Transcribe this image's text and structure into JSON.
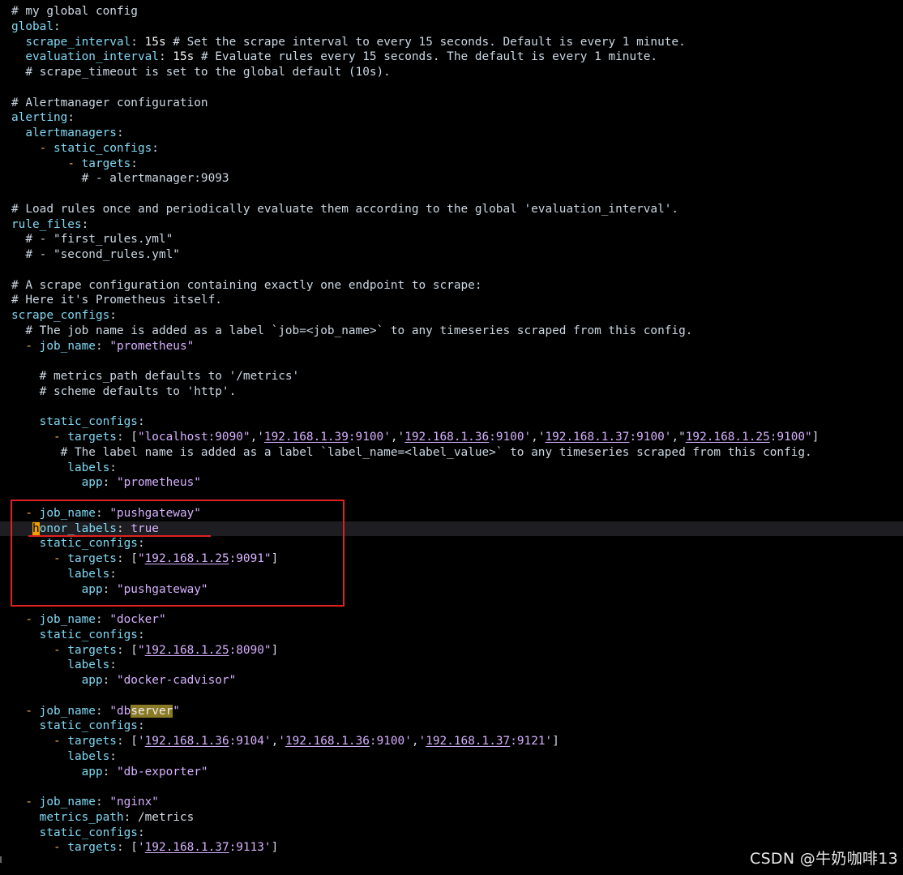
{
  "editor": {
    "lines": [
      [
        {
          "t": "# my global config",
          "c": "comment"
        }
      ],
      [
        {
          "t": "global",
          "c": "key"
        },
        {
          "t": ":",
          "c": "plain"
        }
      ],
      [
        {
          "t": "  scrape_interval",
          "c": "key"
        },
        {
          "t": ": ",
          "c": "plain"
        },
        {
          "t": "15s",
          "c": "num"
        },
        {
          "t": " # Set the scrape interval to every 15 seconds. Default is every 1 minute.",
          "c": "comment"
        }
      ],
      [
        {
          "t": "  evaluation_interval",
          "c": "key"
        },
        {
          "t": ": ",
          "c": "plain"
        },
        {
          "t": "15s",
          "c": "num"
        },
        {
          "t": " # Evaluate rules every 15 seconds. The default is every 1 minute.",
          "c": "comment"
        }
      ],
      [
        {
          "t": "  # scrape_timeout is set to the global default (10s).",
          "c": "comment"
        }
      ],
      [],
      [
        {
          "t": "# Alertmanager configuration",
          "c": "comment"
        }
      ],
      [
        {
          "t": "alerting",
          "c": "key"
        },
        {
          "t": ":",
          "c": "plain"
        }
      ],
      [
        {
          "t": "  alertmanagers",
          "c": "key"
        },
        {
          "t": ":",
          "c": "plain"
        }
      ],
      [
        {
          "t": "    ",
          "c": "plain"
        },
        {
          "t": "-",
          "c": "dash"
        },
        {
          "t": " static_configs",
          "c": "key"
        },
        {
          "t": ":",
          "c": "plain"
        }
      ],
      [
        {
          "t": "        ",
          "c": "plain"
        },
        {
          "t": "-",
          "c": "dash"
        },
        {
          "t": " targets",
          "c": "key"
        },
        {
          "t": ":",
          "c": "plain"
        }
      ],
      [
        {
          "t": "          # - alertmanager:9093",
          "c": "comment"
        }
      ],
      [],
      [
        {
          "t": "# Load rules once and periodically evaluate them according to the global 'evaluation_interval'.",
          "c": "comment"
        }
      ],
      [
        {
          "t": "rule_files",
          "c": "key"
        },
        {
          "t": ":",
          "c": "plain"
        }
      ],
      [
        {
          "t": "  # - \"first_rules.yml\"",
          "c": "comment"
        }
      ],
      [
        {
          "t": "  # - \"second_rules.yml\"",
          "c": "comment"
        }
      ],
      [],
      [
        {
          "t": "# A scrape configuration containing exactly one endpoint to scrape:",
          "c": "comment"
        }
      ],
      [
        {
          "t": "# Here it's Prometheus itself.",
          "c": "comment"
        }
      ],
      [
        {
          "t": "scrape_configs",
          "c": "key"
        },
        {
          "t": ":",
          "c": "plain"
        }
      ],
      [
        {
          "t": "  # The job name is added as a label `job=<job_name>` to any timeseries scraped from this config.",
          "c": "comment"
        }
      ],
      [
        {
          "t": "  ",
          "c": "plain"
        },
        {
          "t": "-",
          "c": "dash"
        },
        {
          "t": " job_name",
          "c": "key"
        },
        {
          "t": ": ",
          "c": "plain"
        },
        {
          "t": "\"prometheus\"",
          "c": "str"
        }
      ],
      [],
      [
        {
          "t": "    # metrics_path defaults to '/metrics'",
          "c": "comment"
        }
      ],
      [
        {
          "t": "    # scheme defaults to 'http'.",
          "c": "comment"
        }
      ],
      [],
      [
        {
          "t": "    static_configs",
          "c": "key"
        },
        {
          "t": ":",
          "c": "plain"
        }
      ],
      [
        {
          "t": "      ",
          "c": "plain"
        },
        {
          "t": "-",
          "c": "dash"
        },
        {
          "t": " targets",
          "c": "key"
        },
        {
          "t": ": [",
          "c": "plain"
        },
        {
          "t": "\"localhost:9090\"",
          "c": "str"
        },
        {
          "t": ",'",
          "c": "plain"
        },
        {
          "t": "192.168.1.39",
          "c": "link"
        },
        {
          "t": ":9100'",
          "c": "str"
        },
        {
          "t": ",'",
          "c": "plain"
        },
        {
          "t": "192.168.1.36",
          "c": "link"
        },
        {
          "t": ":9100'",
          "c": "str"
        },
        {
          "t": ",'",
          "c": "plain"
        },
        {
          "t": "192.168.1.37",
          "c": "link"
        },
        {
          "t": ":9100'",
          "c": "str"
        },
        {
          "t": ",\"",
          "c": "plain"
        },
        {
          "t": "192.168.1.25",
          "c": "link"
        },
        {
          "t": ":9100\"",
          "c": "str"
        },
        {
          "t": "]",
          "c": "plain"
        }
      ],
      [
        {
          "t": "       # The label name is added as a label `label_name=<label_value>` to any timeseries scraped from this config.",
          "c": "comment"
        }
      ],
      [
        {
          "t": "        labels",
          "c": "key"
        },
        {
          "t": ":",
          "c": "plain"
        }
      ],
      [
        {
          "t": "          app",
          "c": "key"
        },
        {
          "t": ": ",
          "c": "plain"
        },
        {
          "t": "\"prometheus\"",
          "c": "str"
        }
      ],
      [],
      [
        {
          "t": "  ",
          "c": "plain"
        },
        {
          "t": "-",
          "c": "dash"
        },
        {
          "t": " job_name",
          "c": "key"
        },
        {
          "t": ": ",
          "c": "plain"
        },
        {
          "t": "\"pushgateway\"",
          "c": "str"
        }
      ],
      [
        {
          "t": "   ",
          "c": "plain"
        },
        {
          "t": "h",
          "c": "cursor"
        },
        {
          "t": "onor_labels",
          "c": "key"
        },
        {
          "t": ": ",
          "c": "plain"
        },
        {
          "t": "true",
          "c": "str"
        }
      ],
      [
        {
          "t": "    static_configs",
          "c": "key"
        },
        {
          "t": ":",
          "c": "plain"
        }
      ],
      [
        {
          "t": "      ",
          "c": "plain"
        },
        {
          "t": "-",
          "c": "dash"
        },
        {
          "t": " targets",
          "c": "key"
        },
        {
          "t": ": [",
          "c": "plain"
        },
        {
          "t": "\"",
          "c": "str"
        },
        {
          "t": "192.168.1.25",
          "c": "link"
        },
        {
          "t": ":9091\"",
          "c": "str"
        },
        {
          "t": "]",
          "c": "plain"
        }
      ],
      [
        {
          "t": "        labels",
          "c": "key"
        },
        {
          "t": ":",
          "c": "plain"
        }
      ],
      [
        {
          "t": "          app",
          "c": "key"
        },
        {
          "t": ": ",
          "c": "plain"
        },
        {
          "t": "\"pushgateway\"",
          "c": "str"
        }
      ],
      [],
      [
        {
          "t": "  ",
          "c": "plain"
        },
        {
          "t": "-",
          "c": "dash"
        },
        {
          "t": " job_name",
          "c": "key"
        },
        {
          "t": ": ",
          "c": "plain"
        },
        {
          "t": "\"docker\"",
          "c": "str"
        }
      ],
      [
        {
          "t": "    static_configs",
          "c": "key"
        },
        {
          "t": ":",
          "c": "plain"
        }
      ],
      [
        {
          "t": "      ",
          "c": "plain"
        },
        {
          "t": "-",
          "c": "dash"
        },
        {
          "t": " targets",
          "c": "key"
        },
        {
          "t": ": [",
          "c": "plain"
        },
        {
          "t": "\"",
          "c": "str"
        },
        {
          "t": "192.168.1.25",
          "c": "link"
        },
        {
          "t": ":8090\"",
          "c": "str"
        },
        {
          "t": "]",
          "c": "plain"
        }
      ],
      [
        {
          "t": "        labels",
          "c": "key"
        },
        {
          "t": ":",
          "c": "plain"
        }
      ],
      [
        {
          "t": "          app",
          "c": "key"
        },
        {
          "t": ": ",
          "c": "plain"
        },
        {
          "t": "\"docker-cadvisor\"",
          "c": "str"
        }
      ],
      [],
      [
        {
          "t": "  ",
          "c": "plain"
        },
        {
          "t": "-",
          "c": "dash"
        },
        {
          "t": " job_name",
          "c": "key"
        },
        {
          "t": ": ",
          "c": "plain"
        },
        {
          "t": "\"db",
          "c": "str"
        },
        {
          "t": "server",
          "c": "hl"
        },
        {
          "t": "\"",
          "c": "str"
        }
      ],
      [
        {
          "t": "    static_configs",
          "c": "key"
        },
        {
          "t": ":",
          "c": "plain"
        }
      ],
      [
        {
          "t": "      ",
          "c": "plain"
        },
        {
          "t": "-",
          "c": "dash"
        },
        {
          "t": " targets",
          "c": "key"
        },
        {
          "t": ": [",
          "c": "plain"
        },
        {
          "t": "'",
          "c": "str"
        },
        {
          "t": "192.168.1.36",
          "c": "link"
        },
        {
          "t": ":9104'",
          "c": "str"
        },
        {
          "t": ",",
          "c": "plain"
        },
        {
          "t": "'",
          "c": "str"
        },
        {
          "t": "192.168.1.36",
          "c": "link"
        },
        {
          "t": ":9100'",
          "c": "str"
        },
        {
          "t": ",",
          "c": "plain"
        },
        {
          "t": "'",
          "c": "str"
        },
        {
          "t": "192.168.1.37",
          "c": "link"
        },
        {
          "t": ":9121'",
          "c": "str"
        },
        {
          "t": "]",
          "c": "plain"
        }
      ],
      [
        {
          "t": "        labels",
          "c": "key"
        },
        {
          "t": ":",
          "c": "plain"
        }
      ],
      [
        {
          "t": "          app",
          "c": "key"
        },
        {
          "t": ": ",
          "c": "plain"
        },
        {
          "t": "\"db-exporter\"",
          "c": "str"
        }
      ],
      [],
      [
        {
          "t": "  ",
          "c": "plain"
        },
        {
          "t": "-",
          "c": "dash"
        },
        {
          "t": " job_name",
          "c": "key"
        },
        {
          "t": ": ",
          "c": "plain"
        },
        {
          "t": "\"nginx\"",
          "c": "str"
        }
      ],
      [
        {
          "t": "    metrics_path",
          "c": "key"
        },
        {
          "t": ": ",
          "c": "plain"
        },
        {
          "t": "/metrics",
          "c": "plain"
        }
      ],
      [
        {
          "t": "    static_configs",
          "c": "key"
        },
        {
          "t": ":",
          "c": "plain"
        }
      ],
      [
        {
          "t": "      ",
          "c": "plain"
        },
        {
          "t": "-",
          "c": "dash"
        },
        {
          "t": " targets",
          "c": "key"
        },
        {
          "t": ": [",
          "c": "plain"
        },
        {
          "t": "'",
          "c": "str"
        },
        {
          "t": "192.168.1.37",
          "c": "link"
        },
        {
          "t": ":9113'",
          "c": "str"
        },
        {
          "t": "]",
          "c": "plain"
        }
      ]
    ],
    "cursor_line": 34
  },
  "watermark": "CSDN @牛奶咖啡13",
  "colors": {
    "background": "#000000",
    "key": "#7fd9f4",
    "string": "#d7b0ff",
    "dash": "#ffb34a",
    "annotation": "#e02020"
  }
}
